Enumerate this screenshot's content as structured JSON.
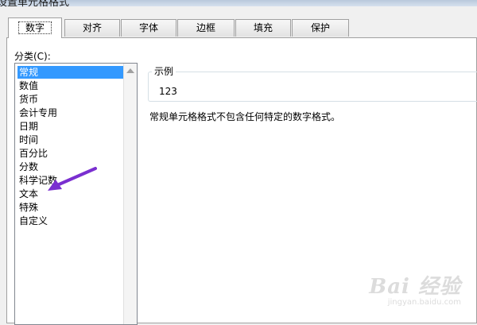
{
  "window": {
    "title": "设置单元格格式"
  },
  "tabs": [
    {
      "label": "数字",
      "active": true
    },
    {
      "label": "对齐",
      "active": false
    },
    {
      "label": "字体",
      "active": false
    },
    {
      "label": "边框",
      "active": false
    },
    {
      "label": "填充",
      "active": false
    },
    {
      "label": "保护",
      "active": false
    }
  ],
  "category": {
    "label": "分类(C):",
    "selected": "常规",
    "items": [
      "常规",
      "数值",
      "货币",
      "会计专用",
      "日期",
      "时间",
      "百分比",
      "分数",
      "科学记数",
      "文本",
      "特殊",
      "自定义"
    ]
  },
  "sample": {
    "title": "示例",
    "value": "123"
  },
  "description": "常规单元格格式不包含任何特定的数字格式。",
  "watermark": {
    "brand": "Bai 经验",
    "url": "jingyan.baidu.com"
  },
  "colors": {
    "selection": "#3399ff",
    "arrow": "#7a2fd0",
    "panel": "#ffffff",
    "dialog": "#f0f0f0"
  }
}
